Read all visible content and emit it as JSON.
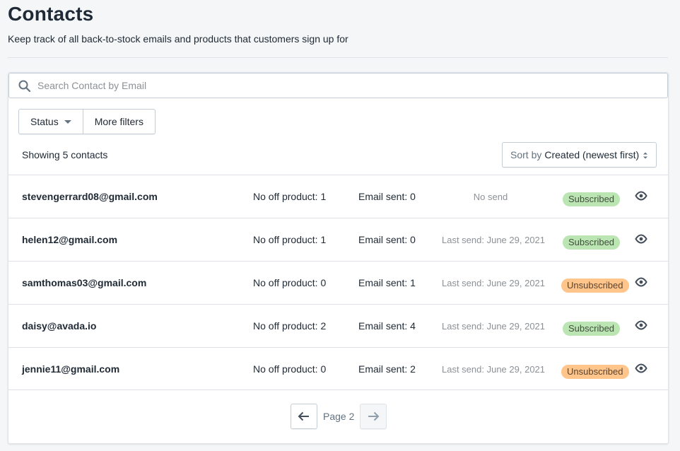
{
  "header": {
    "title": "Contacts",
    "subtitle": "Keep track of all back-to-stock emails and products that customers sign up for"
  },
  "search": {
    "placeholder": "Search Contact by Email",
    "value": ""
  },
  "filters": {
    "status_label": "Status",
    "more_label": "More filters"
  },
  "summary": {
    "showing": "Showing 5 contacts"
  },
  "sort": {
    "label": "Sort by",
    "value": "Created (newest first)"
  },
  "contacts": [
    {
      "email": "stevengerrard08@gmail.com",
      "product": "No off product: 1",
      "sent": "Email sent: 0",
      "last_send": "No send",
      "status": "Subscribed"
    },
    {
      "email": "helen12@gmail.com",
      "product": "No off product: 1",
      "sent": "Email sent: 0",
      "last_send": "Last send: June 29, 2021",
      "status": "Subscribed"
    },
    {
      "email": "samthomas03@gmail.com",
      "product": "No off product: 0",
      "sent": "Email sent: 1",
      "last_send": "Last send: June 29, 2021",
      "status": "Unsubscribed"
    },
    {
      "email": "daisy@avada.io",
      "product": "No off product: 2",
      "sent": "Email sent: 4",
      "last_send": "Last send: June 29, 2021",
      "status": "Subscribed"
    },
    {
      "email": "jennie11@gmail.com",
      "product": "No off product: 0",
      "sent": "Email sent: 2",
      "last_send": "Last send: June 29, 2021",
      "status": "Unsubscribed"
    }
  ],
  "pagination": {
    "label": "Page 2"
  },
  "colors": {
    "subscribed_badge": "#bbe5b3",
    "unsubscribed_badge": "#ffc58b",
    "background": "#f4f6f8"
  },
  "icons": [
    "search-icon",
    "caret-down-icon",
    "sort-arrows-icon",
    "eye-icon",
    "arrow-left-icon",
    "arrow-right-icon"
  ]
}
